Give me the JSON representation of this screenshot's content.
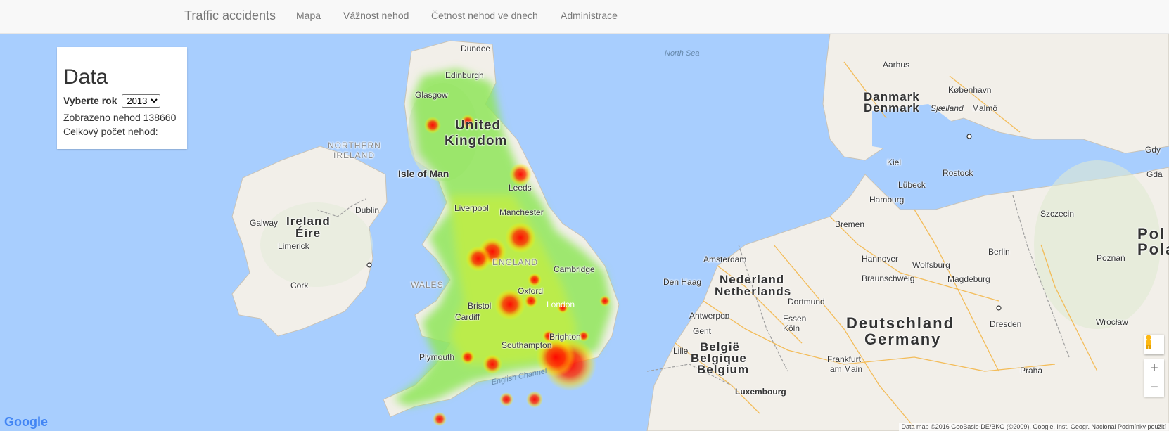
{
  "nav": {
    "brand": "Traffic accidents",
    "items": [
      "Mapa",
      "Vážnost nehod",
      "Četnost nehod ve dnech",
      "Administrace"
    ]
  },
  "panel": {
    "title": "Data",
    "year_label": "Vyberte rok",
    "year_value": "2013",
    "shown_label": "Zobrazeno nehod 138660",
    "total_label": "Celkový počet nehod:"
  },
  "map": {
    "labels": {
      "north_sea": "North Sea",
      "english_channel": "English Channel",
      "uk1": "United",
      "uk2": "Kingdom",
      "isle_of_man": "Isle of Man",
      "ni1": "NORTHERN",
      "ni2": "IRELAND",
      "ireland1": "Ireland",
      "ireland2": "Éire",
      "dublin": "Dublin",
      "galway": "Galway",
      "limerick": "Limerick",
      "cork": "Cork",
      "wales": "WALES",
      "england": "ENGLAND",
      "dundee": "Dundee",
      "edinburgh": "Edinburgh",
      "glasgow": "Glasgow",
      "leeds": "Leeds",
      "liverpool": "Liverpool",
      "manchester": "Manchester",
      "cambridge": "Cambridge",
      "oxford": "Oxford",
      "bristol": "Bristol",
      "cardiff": "Cardiff",
      "london": "London",
      "brighton": "Brighton",
      "southampton": "Southampton",
      "plymouth": "Plymouth",
      "denmark1": "Danmark",
      "denmark2": "Denmark",
      "aarhus": "Aarhus",
      "kobenhavn": "København",
      "sjaelland": "Sjælland",
      "malmo": "Malmö",
      "kiel": "Kiel",
      "rostock": "Rostock",
      "lubeck": "Lübeck",
      "hamburg": "Hamburg",
      "bremen": "Bremen",
      "szczecin": "Szczecin",
      "amsterdam": "Amsterdam",
      "denhaag": "Den Haag",
      "nl1": "Nederland",
      "nl2": "Netherlands",
      "hannover": "Hannover",
      "wolfsburg": "Wolfsburg",
      "berlin": "Berlin",
      "braunschweig": "Braunschweig",
      "magdeburg": "Magdeburg",
      "dortmund": "Dortmund",
      "essen": "Essen",
      "antwerpen": "Antwerpen",
      "gent": "Gent",
      "koln": "Köln",
      "lille": "Lille",
      "be1": "België",
      "be2": "Belgique",
      "be3": "Belgium",
      "de1": "Deutschland",
      "de2": "Germany",
      "dresden": "Dresden",
      "wroclaw": "Wrocław",
      "poznan": "Poznań",
      "frankfurt1": "Frankfurt",
      "frankfurt2": "am Main",
      "praha": "Praha",
      "luxembourg": "Luxembourg",
      "pol1": "Pol",
      "pol2": "Pola",
      "gdy": "Gdy",
      "gda": "Gda"
    },
    "attribution": "Data map ©2016 GeoBasis-DE/BKG (©2009), Google, Inst. Geogr. Nacional   Podmínky použití",
    "logo": "Google"
  }
}
